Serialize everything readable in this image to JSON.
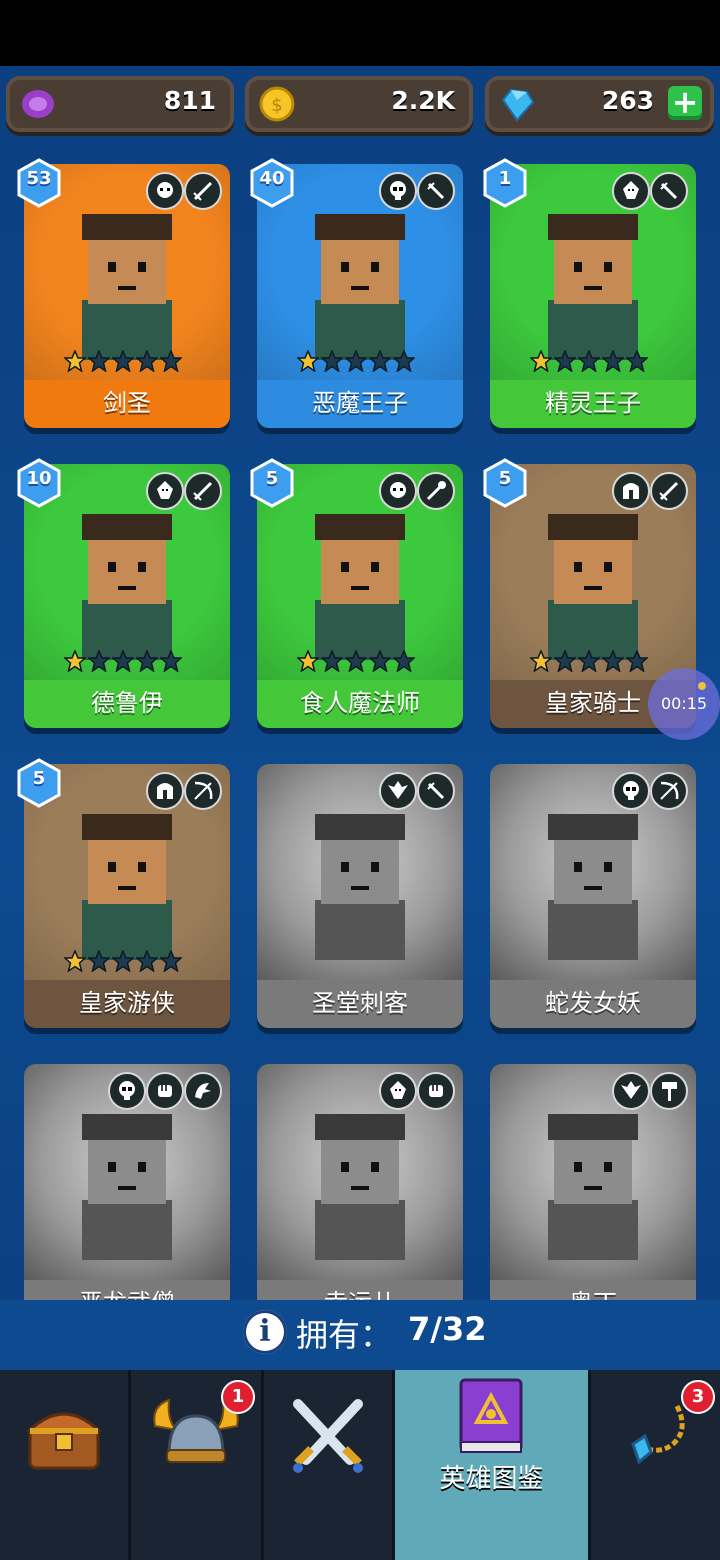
{
  "currency": {
    "orb": {
      "value": "811",
      "icon": "purple-orb-icon"
    },
    "gold": {
      "value": "2.2K",
      "icon": "gold-coin-icon"
    },
    "gems": {
      "value": "263",
      "icon": "blue-gem-icon",
      "add": "+"
    }
  },
  "heroes": [
    {
      "name": "剑圣",
      "level": "53",
      "stars": 1,
      "owned": true,
      "color": "#f2841e",
      "name_bg": "#f07a10",
      "badges": [
        "orc-face-icon",
        "sword-icon"
      ]
    },
    {
      "name": "恶魔王子",
      "level": "40",
      "stars": 1,
      "owned": true,
      "color": "#2e8fe6",
      "name_bg": "#2d8be0",
      "badges": [
        "skull-icon",
        "dagger-icon"
      ]
    },
    {
      "name": "精灵王子",
      "level": "1",
      "stars": 1,
      "owned": true,
      "color": "#3dc93d",
      "name_bg": "#44c83a",
      "badges": [
        "elf-face-icon",
        "dagger-icon"
      ]
    },
    {
      "name": "德鲁伊",
      "level": "10",
      "stars": 1,
      "owned": true,
      "color": "#3dc93d",
      "name_bg": "#44c83a",
      "badges": [
        "elf-face-icon",
        "sword-icon"
      ]
    },
    {
      "name": "食人魔法师",
      "level": "5",
      "stars": 1,
      "owned": true,
      "color": "#3dc93d",
      "name_bg": "#44c83a",
      "badges": [
        "orc-face-icon",
        "staff-icon"
      ]
    },
    {
      "name": "皇家骑士",
      "level": "5",
      "stars": 1,
      "owned": true,
      "color": "#9b7d5a",
      "name_bg": "#6d5540",
      "badges": [
        "helmet-icon",
        "sword-icon"
      ]
    },
    {
      "name": "皇家游侠",
      "level": "5",
      "stars": 1,
      "owned": true,
      "color": "#9b7d5a",
      "name_bg": "#6d5540",
      "badges": [
        "helmet-icon",
        "bow-icon"
      ]
    },
    {
      "name": "圣堂刺客",
      "level": "",
      "stars": 0,
      "owned": false,
      "color": "#8a8a8a",
      "name_bg": "#7a7a7a",
      "badges": [
        "winged-emblem-icon",
        "dagger-icon"
      ]
    },
    {
      "name": "蛇发女妖",
      "level": "",
      "stars": 0,
      "owned": false,
      "color": "#8a8a8a",
      "name_bg": "#7a7a7a",
      "badges": [
        "skull-icon",
        "bow-icon"
      ]
    },
    {
      "name": "恶龙武僧",
      "level": "",
      "stars": 0,
      "owned": false,
      "color": "#8a8a8a",
      "name_bg": "#7a7a7a",
      "badges": [
        "skull-icon",
        "fist-icon",
        "dragon-icon"
      ]
    },
    {
      "name": "幸运儿",
      "level": "",
      "stars": 0,
      "owned": false,
      "color": "#8a8a8a",
      "name_bg": "#7a7a7a",
      "badges": [
        "elf-face-icon",
        "fist-icon"
      ]
    },
    {
      "name": "奥丁",
      "level": "",
      "stars": 0,
      "owned": false,
      "color": "#8a8a8a",
      "name_bg": "#7a7a7a",
      "badges": [
        "winged-emblem-icon",
        "hammer-icon"
      ]
    }
  ],
  "owned": {
    "label": "拥有：",
    "count": "7/32"
  },
  "nav": {
    "tabs": [
      {
        "icon": "treasure-chest-icon",
        "label": ""
      },
      {
        "icon": "viking-helmet-icon",
        "label": "",
        "badge": "1"
      },
      {
        "icon": "crossed-swords-icon",
        "label": ""
      },
      {
        "icon": "hero-book-icon",
        "label": "英雄图鉴"
      },
      {
        "icon": "amulet-icon",
        "label": "",
        "badge": "3"
      }
    ]
  },
  "timer": "00:15"
}
